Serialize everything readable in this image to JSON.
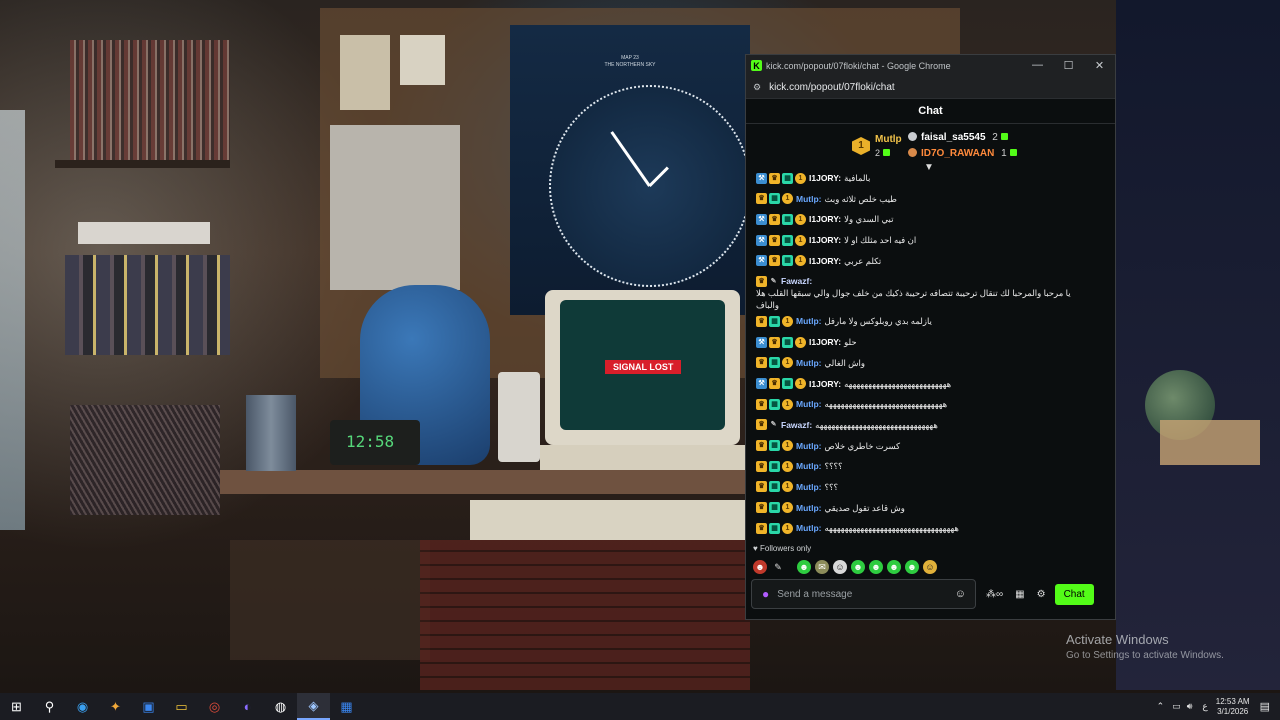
{
  "wallpaper": {
    "poster_title_line1": "MAP 23",
    "poster_title_line2": "THE NORTHERN SKY",
    "signal_text": "SIGNAL LOST",
    "desk_clock": "12:58"
  },
  "window": {
    "title": "kick.com/popout/07floki/chat - Google Chrome",
    "url": "kick.com/popout/07floki/chat",
    "logo": "K",
    "minimize": "—",
    "maximize": "☐",
    "close": "✕"
  },
  "chat": {
    "header": "Chat",
    "leaderboard": {
      "first_rank": "1",
      "first_name": "Mutlp",
      "first_count": "2",
      "second_name": "faisal_sa5545",
      "second_count": "2",
      "third_name": "ID7O_RAWAAN",
      "third_count": "1"
    },
    "messages": [
      {
        "user": "I1JORY:",
        "text": "بالمافية"
      },
      {
        "user": "Mutlp:",
        "text": "طيب خلص ثلاثه وبث"
      },
      {
        "user": "I1JORY:",
        "text": "تبي السدي ولا"
      },
      {
        "user": "I1JORY:",
        "text": "ان فيه احد مثلك او لا"
      },
      {
        "user": "I1JORY:",
        "text": "تكلم عربي"
      },
      {
        "user": "Fawazf:",
        "text": "يا مرحبا والمرحبا لك تنقال ترحيبة تتصافه ترحيبة ذكيك من خلف جوال والي سبقها القلب هلا",
        "wrap": "والباف"
      },
      {
        "user": "Mutlp:",
        "text": "يازلمه بدي روبلوكس ولا مارفل"
      },
      {
        "user": "I1JORY:",
        "text": "حلو"
      },
      {
        "user": "Mutlp:",
        "text": "واش الغالي"
      },
      {
        "user": "I1JORY:",
        "text": "ههههههههههههههههههههههههههه"
      },
      {
        "user": "Mutlp:",
        "text": "ههههههههههههههههههههههههههههههه"
      },
      {
        "user": "Fawazf:",
        "text": "ههههههههههههههههههههههههههههههه"
      },
      {
        "user": "Mutlp:",
        "text": "كسرت خاطري خلاص"
      },
      {
        "user": "Mutlp:",
        "text": "؟؟؟؟"
      },
      {
        "user": "Mutlp:",
        "text": "؟؟؟"
      },
      {
        "user": "Mutlp:",
        "text": "وش قاعد تقول صديقي"
      },
      {
        "user": "Mutlp:",
        "text": "هههههههههههههههههههههههههههههههههه"
      }
    ],
    "followers_only": "Followers only",
    "input_placeholder": "Send a message",
    "send_label": "Chat"
  },
  "watermark": {
    "line1": "Activate Windows",
    "line2": "Go to Settings to activate Windows."
  },
  "taskbar": {
    "lang": "ع",
    "time": "12:53 AM",
    "date": "3/1/2026"
  },
  "colors": {
    "kick_green": "#53fc18",
    "username_blue": "#6aa8ff",
    "gold": "#f2c34a"
  }
}
